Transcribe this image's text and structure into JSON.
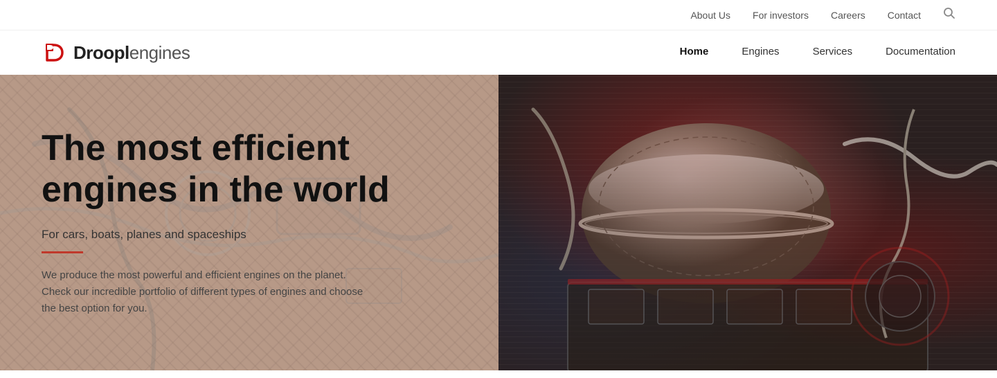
{
  "header": {
    "logo_bold": "Droopl",
    "logo_light": "engines",
    "top_nav": {
      "about": "About Us",
      "investors": "For investors",
      "careers": "Careers",
      "contact": "Contact"
    },
    "main_nav": [
      {
        "label": "Home",
        "active": true
      },
      {
        "label": "Engines",
        "active": false
      },
      {
        "label": "Services",
        "active": false
      },
      {
        "label": "Documentation",
        "active": false
      }
    ]
  },
  "hero": {
    "heading": "The most efficient engines in the world",
    "subheading": "For cars, boats, planes and spaceships",
    "description": "We produce the most powerful and efficient engines on the planet. Check our incredible portfolio of different types of engines and choose the best option for you."
  }
}
